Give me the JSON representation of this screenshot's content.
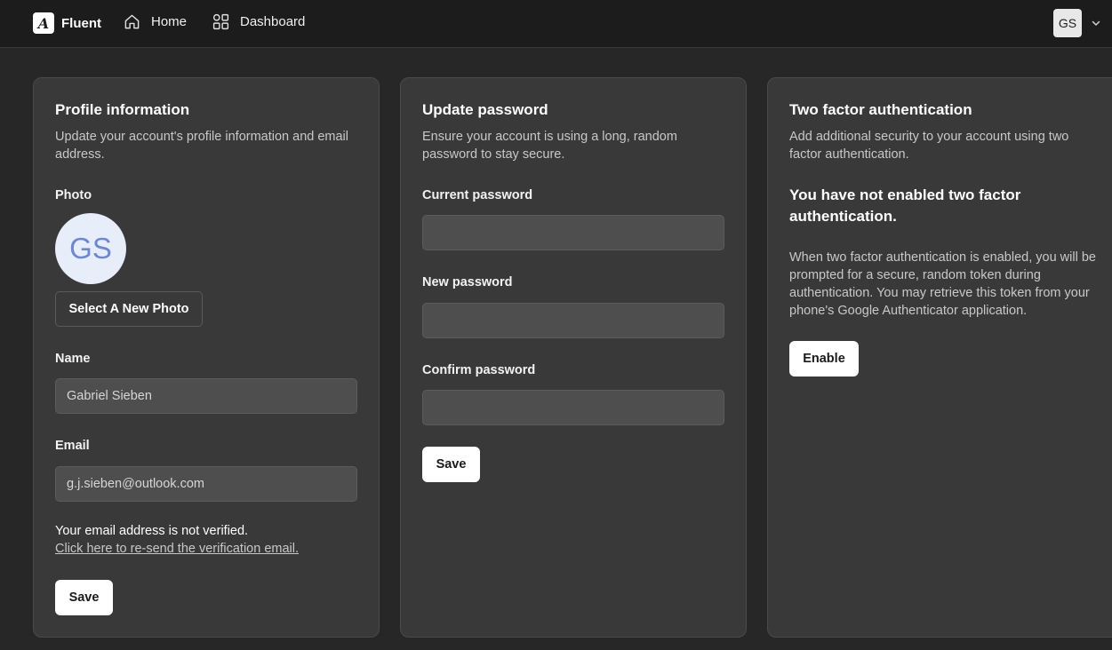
{
  "header": {
    "brand_name": "Fluent",
    "brand_logo_letter": "A",
    "nav": [
      {
        "label": "Home",
        "icon": "home-icon"
      },
      {
        "label": "Dashboard",
        "icon": "grid-icon"
      }
    ],
    "user_initials": "GS",
    "menu_icon": "chevron-down-icon"
  },
  "profile": {
    "title": "Profile information",
    "description": "Update your account's profile information and email address.",
    "photo_label": "Photo",
    "photo_initials": "GS",
    "select_photo_label": "Select A New Photo",
    "name_label": "Name",
    "name_value": "Gabriel Sieben",
    "email_label": "Email",
    "email_value": "g.j.sieben@outlook.com",
    "unverified_text": "Your email address is not verified.",
    "resend_link": "Click here to re-send the verification email.",
    "save_label": "Save"
  },
  "password": {
    "title": "Update password",
    "description": "Ensure your account is using a long, random password to stay secure.",
    "current_label": "Current password",
    "current_value": "",
    "new_label": "New password",
    "new_value": "",
    "confirm_label": "Confirm password",
    "confirm_value": "",
    "save_label": "Save"
  },
  "two_factor": {
    "title": "Two factor authentication",
    "description": "Add additional security to your account using two factor authentication.",
    "status_heading": "You have not enabled two factor authentication.",
    "body": "When two factor authentication is enabled, you will be prompted for a secure, random token during authentication. You may retrieve this token from your phone's Google Authenticator application.",
    "enable_label": "Enable"
  },
  "colors": {
    "background": "#272727",
    "header": "#1c1c1c",
    "card": "#393939",
    "input": "#4e4e4e",
    "avatar_text": "#6b88d8"
  }
}
